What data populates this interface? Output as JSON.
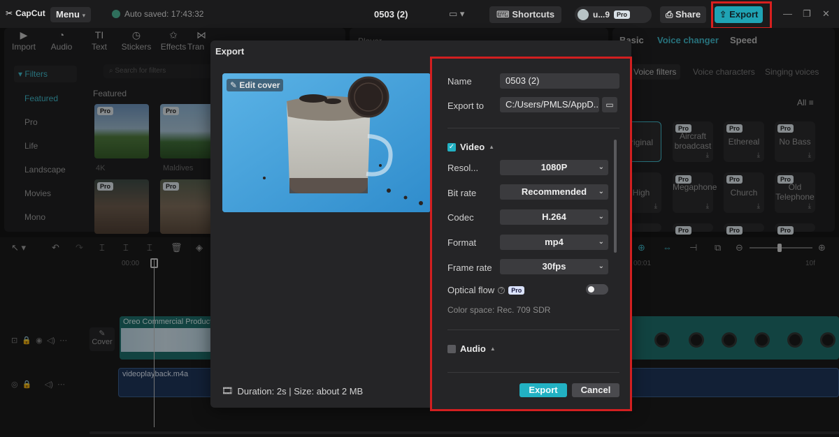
{
  "app": {
    "logo_text": "CapCut",
    "menu_label": "Menu",
    "autosave_text": "Auto saved: 17:43:32",
    "project_title": "0503 (2)",
    "shortcuts_label": "Shortcuts",
    "user_name": "u...9",
    "user_badge": "Pro",
    "share_label": "Share",
    "export_label": "Export"
  },
  "toolbar": {
    "tools": [
      {
        "label": "Import",
        "icon": "import-icon"
      },
      {
        "label": "Audio",
        "icon": "audio-icon"
      },
      {
        "label": "Text",
        "icon": "text-icon"
      },
      {
        "label": "Stickers",
        "icon": "stickers-icon"
      },
      {
        "label": "Effects",
        "icon": "effects-icon"
      },
      {
        "label": "Tran",
        "icon": "transitions-icon"
      }
    ]
  },
  "filters_panel": {
    "filters_label": "Filters",
    "search_placeholder": "Search for filters",
    "categories": [
      "Featured",
      "Pro",
      "Life",
      "Landscape",
      "Movies",
      "Mono"
    ],
    "featured_heading": "Featured",
    "thumb_labels": [
      "4K",
      "Maldives"
    ],
    "pro_badge": "Pro"
  },
  "player": {
    "label": "Player"
  },
  "right_panel": {
    "tabs": [
      "Basic",
      "Voice changer",
      "Speed"
    ],
    "subtabs": [
      "Voice filters",
      "Voice characters",
      "Singing voices"
    ],
    "all_label": "All",
    "voices_row1": [
      "riginal",
      "Aircraft broadcast",
      "Ethereal",
      "No Bass"
    ],
    "voices_row2": [
      "High",
      "Megaphone",
      "Church",
      "Old Telephone"
    ]
  },
  "timeline": {
    "ruler_start": "00:00",
    "ruler_mid": "00:01",
    "ruler_end": "10f",
    "video_clip_label": "Oreo Commercial Product",
    "audio_clip_label": "videoplayback.m4a",
    "cover_label": "Cover"
  },
  "export_dialog": {
    "title": "Export",
    "edit_cover_label": "Edit cover",
    "duration_text": "Duration: 2s | Size: about 2 MB",
    "name_label": "Name",
    "name_value": "0503 (2)",
    "export_to_label": "Export to",
    "export_to_value": "C:/Users/PMLS/AppD...",
    "video_section": "Video",
    "video_checked": true,
    "resolution_label": "Resol...",
    "resolution_value": "1080P",
    "bitrate_label": "Bit rate",
    "bitrate_value": "Recommended",
    "codec_label": "Codec",
    "codec_value": "H.264",
    "format_label": "Format",
    "format_value": "mp4",
    "framerate_label": "Frame rate",
    "framerate_value": "30fps",
    "optical_flow_label": "Optical flow",
    "optical_flow_badge": "Pro",
    "optical_flow_on": false,
    "color_space": "Color space: Rec. 709 SDR",
    "audio_section": "Audio",
    "audio_checked": false,
    "export_button": "Export",
    "cancel_button": "Cancel"
  },
  "colors": {
    "accent": "#22b1c3",
    "highlight_frame": "#d21f20",
    "video_track": "#1e6d6a",
    "audio_track": "#1d3558"
  }
}
